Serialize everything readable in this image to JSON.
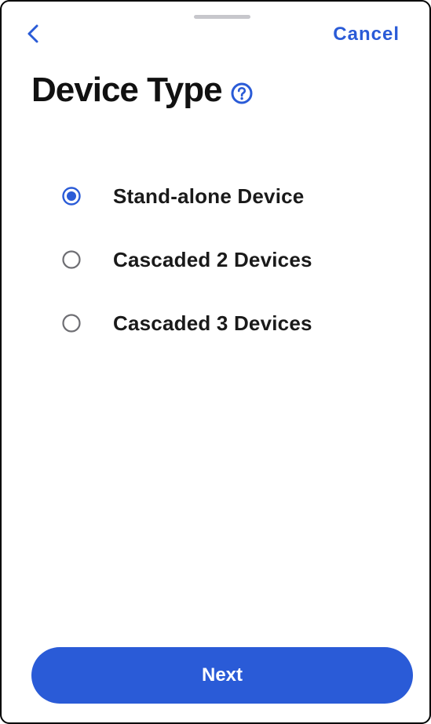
{
  "header": {
    "cancel_label": "Cancel"
  },
  "title": {
    "text": "Device Type",
    "help_icon": "question-circle-icon"
  },
  "device_options": [
    {
      "label": "Stand-alone Device",
      "selected": true
    },
    {
      "label": "Cascaded 2 Devices",
      "selected": false
    },
    {
      "label": "Cascaded 3 Devices",
      "selected": false
    }
  ],
  "footer": {
    "next_label": "Next"
  },
  "colors": {
    "accent": "#2a5bd7",
    "radio_unselected": "#6e6e73",
    "text": "#111111",
    "grabber": "#c7c7cc"
  }
}
